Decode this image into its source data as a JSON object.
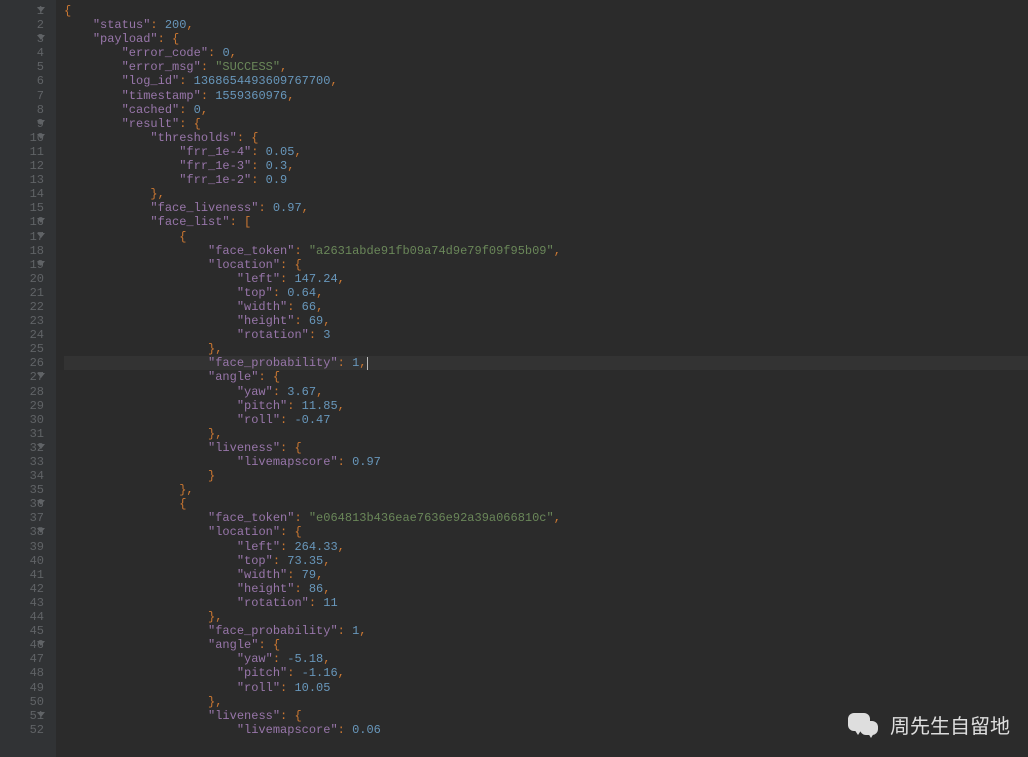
{
  "watermark_text": "周先生自留地",
  "highlighted_line": 26,
  "lines": [
    {
      "n": 1,
      "fold": true,
      "t": [
        [
          "p",
          "{"
        ]
      ]
    },
    {
      "n": 2,
      "t": [
        [
          "",
          "    "
        ],
        [
          "k",
          "\"status\""
        ],
        [
          "p",
          ": "
        ],
        [
          "n",
          "200"
        ],
        [
          "p",
          ","
        ]
      ]
    },
    {
      "n": 3,
      "fold": true,
      "t": [
        [
          "",
          "    "
        ],
        [
          "k",
          "\"payload\""
        ],
        [
          "p",
          ": {"
        ]
      ]
    },
    {
      "n": 4,
      "t": [
        [
          "",
          "        "
        ],
        [
          "k",
          "\"error_code\""
        ],
        [
          "p",
          ": "
        ],
        [
          "n",
          "0"
        ],
        [
          "p",
          ","
        ]
      ]
    },
    {
      "n": 5,
      "t": [
        [
          "",
          "        "
        ],
        [
          "k",
          "\"error_msg\""
        ],
        [
          "p",
          ": "
        ],
        [
          "s",
          "\"SUCCESS\""
        ],
        [
          "p",
          ","
        ]
      ]
    },
    {
      "n": 6,
      "t": [
        [
          "",
          "        "
        ],
        [
          "k",
          "\"log_id\""
        ],
        [
          "p",
          ": "
        ],
        [
          "n",
          "1368654493609767700"
        ],
        [
          "p",
          ","
        ]
      ]
    },
    {
      "n": 7,
      "t": [
        [
          "",
          "        "
        ],
        [
          "k",
          "\"timestamp\""
        ],
        [
          "p",
          ": "
        ],
        [
          "n",
          "1559360976"
        ],
        [
          "p",
          ","
        ]
      ]
    },
    {
      "n": 8,
      "t": [
        [
          "",
          "        "
        ],
        [
          "k",
          "\"cached\""
        ],
        [
          "p",
          ": "
        ],
        [
          "n",
          "0"
        ],
        [
          "p",
          ","
        ]
      ]
    },
    {
      "n": 9,
      "fold": true,
      "t": [
        [
          "",
          "        "
        ],
        [
          "k",
          "\"result\""
        ],
        [
          "p",
          ": {"
        ]
      ]
    },
    {
      "n": 10,
      "fold": true,
      "t": [
        [
          "",
          "            "
        ],
        [
          "k",
          "\"thresholds\""
        ],
        [
          "p",
          ": {"
        ]
      ]
    },
    {
      "n": 11,
      "t": [
        [
          "",
          "                "
        ],
        [
          "k",
          "\"frr_1e-4\""
        ],
        [
          "p",
          ": "
        ],
        [
          "n",
          "0.05"
        ],
        [
          "p",
          ","
        ]
      ]
    },
    {
      "n": 12,
      "t": [
        [
          "",
          "                "
        ],
        [
          "k",
          "\"frr_1e-3\""
        ],
        [
          "p",
          ": "
        ],
        [
          "n",
          "0.3"
        ],
        [
          "p",
          ","
        ]
      ]
    },
    {
      "n": 13,
      "t": [
        [
          "",
          "                "
        ],
        [
          "k",
          "\"frr_1e-2\""
        ],
        [
          "p",
          ": "
        ],
        [
          "n",
          "0.9"
        ]
      ]
    },
    {
      "n": 14,
      "t": [
        [
          "",
          "            "
        ],
        [
          "p",
          "},"
        ]
      ]
    },
    {
      "n": 15,
      "t": [
        [
          "",
          "            "
        ],
        [
          "k",
          "\"face_liveness\""
        ],
        [
          "p",
          ": "
        ],
        [
          "n",
          "0.97"
        ],
        [
          "p",
          ","
        ]
      ]
    },
    {
      "n": 16,
      "fold": true,
      "t": [
        [
          "",
          "            "
        ],
        [
          "k",
          "\"face_list\""
        ],
        [
          "p",
          ": ["
        ]
      ]
    },
    {
      "n": 17,
      "fold": true,
      "t": [
        [
          "",
          "                "
        ],
        [
          "p",
          "{"
        ]
      ]
    },
    {
      "n": 18,
      "t": [
        [
          "",
          "                    "
        ],
        [
          "k",
          "\"face_token\""
        ],
        [
          "p",
          ": "
        ],
        [
          "s",
          "\"a2631abde91fb09a74d9e79f09f95b09\""
        ],
        [
          "p",
          ","
        ]
      ]
    },
    {
      "n": 19,
      "fold": true,
      "t": [
        [
          "",
          "                    "
        ],
        [
          "k",
          "\"location\""
        ],
        [
          "p",
          ": {"
        ]
      ]
    },
    {
      "n": 20,
      "t": [
        [
          "",
          "                        "
        ],
        [
          "k",
          "\"left\""
        ],
        [
          "p",
          ": "
        ],
        [
          "n",
          "147.24"
        ],
        [
          "p",
          ","
        ]
      ]
    },
    {
      "n": 21,
      "t": [
        [
          "",
          "                        "
        ],
        [
          "k",
          "\"top\""
        ],
        [
          "p",
          ": "
        ],
        [
          "n",
          "0.64"
        ],
        [
          "p",
          ","
        ]
      ]
    },
    {
      "n": 22,
      "t": [
        [
          "",
          "                        "
        ],
        [
          "k",
          "\"width\""
        ],
        [
          "p",
          ": "
        ],
        [
          "n",
          "66"
        ],
        [
          "p",
          ","
        ]
      ]
    },
    {
      "n": 23,
      "t": [
        [
          "",
          "                        "
        ],
        [
          "k",
          "\"height\""
        ],
        [
          "p",
          ": "
        ],
        [
          "n",
          "69"
        ],
        [
          "p",
          ","
        ]
      ]
    },
    {
      "n": 24,
      "t": [
        [
          "",
          "                        "
        ],
        [
          "k",
          "\"rotation\""
        ],
        [
          "p",
          ": "
        ],
        [
          "n",
          "3"
        ]
      ]
    },
    {
      "n": 25,
      "t": [
        [
          "",
          "                    "
        ],
        [
          "p",
          "},"
        ]
      ]
    },
    {
      "n": 26,
      "t": [
        [
          "",
          "                    "
        ],
        [
          "k",
          "\"face_probability\""
        ],
        [
          "p",
          ": "
        ],
        [
          "n",
          "1"
        ],
        [
          "p",
          ","
        ],
        [
          "cursor",
          ""
        ]
      ]
    },
    {
      "n": 27,
      "fold": true,
      "t": [
        [
          "",
          "                    "
        ],
        [
          "k",
          "\"angle\""
        ],
        [
          "p",
          ": {"
        ]
      ]
    },
    {
      "n": 28,
      "t": [
        [
          "",
          "                        "
        ],
        [
          "k",
          "\"yaw\""
        ],
        [
          "p",
          ": "
        ],
        [
          "n",
          "3.67"
        ],
        [
          "p",
          ","
        ]
      ]
    },
    {
      "n": 29,
      "t": [
        [
          "",
          "                        "
        ],
        [
          "k",
          "\"pitch\""
        ],
        [
          "p",
          ": "
        ],
        [
          "n",
          "11.85"
        ],
        [
          "p",
          ","
        ]
      ]
    },
    {
      "n": 30,
      "t": [
        [
          "",
          "                        "
        ],
        [
          "k",
          "\"roll\""
        ],
        [
          "p",
          ": "
        ],
        [
          "n",
          "-0.47"
        ]
      ]
    },
    {
      "n": 31,
      "t": [
        [
          "",
          "                    "
        ],
        [
          "p",
          "},"
        ]
      ]
    },
    {
      "n": 32,
      "fold": true,
      "t": [
        [
          "",
          "                    "
        ],
        [
          "k",
          "\"liveness\""
        ],
        [
          "p",
          ": {"
        ]
      ]
    },
    {
      "n": 33,
      "t": [
        [
          "",
          "                        "
        ],
        [
          "k",
          "\"livemapscore\""
        ],
        [
          "p",
          ": "
        ],
        [
          "n",
          "0.97"
        ]
      ]
    },
    {
      "n": 34,
      "t": [
        [
          "",
          "                    "
        ],
        [
          "p",
          "}"
        ]
      ]
    },
    {
      "n": 35,
      "t": [
        [
          "",
          "                "
        ],
        [
          "p",
          "},"
        ]
      ]
    },
    {
      "n": 36,
      "fold": true,
      "t": [
        [
          "",
          "                "
        ],
        [
          "p",
          "{"
        ]
      ]
    },
    {
      "n": 37,
      "t": [
        [
          "",
          "                    "
        ],
        [
          "k",
          "\"face_token\""
        ],
        [
          "p",
          ": "
        ],
        [
          "s",
          "\"e064813b436eae7636e92a39a066810c\""
        ],
        [
          "p",
          ","
        ]
      ]
    },
    {
      "n": 38,
      "fold": true,
      "t": [
        [
          "",
          "                    "
        ],
        [
          "k",
          "\"location\""
        ],
        [
          "p",
          ": {"
        ]
      ]
    },
    {
      "n": 39,
      "t": [
        [
          "",
          "                        "
        ],
        [
          "k",
          "\"left\""
        ],
        [
          "p",
          ": "
        ],
        [
          "n",
          "264.33"
        ],
        [
          "p",
          ","
        ]
      ]
    },
    {
      "n": 40,
      "t": [
        [
          "",
          "                        "
        ],
        [
          "k",
          "\"top\""
        ],
        [
          "p",
          ": "
        ],
        [
          "n",
          "73.35"
        ],
        [
          "p",
          ","
        ]
      ]
    },
    {
      "n": 41,
      "t": [
        [
          "",
          "                        "
        ],
        [
          "k",
          "\"width\""
        ],
        [
          "p",
          ": "
        ],
        [
          "n",
          "79"
        ],
        [
          "p",
          ","
        ]
      ]
    },
    {
      "n": 42,
      "t": [
        [
          "",
          "                        "
        ],
        [
          "k",
          "\"height\""
        ],
        [
          "p",
          ": "
        ],
        [
          "n",
          "86"
        ],
        [
          "p",
          ","
        ]
      ]
    },
    {
      "n": 43,
      "t": [
        [
          "",
          "                        "
        ],
        [
          "k",
          "\"rotation\""
        ],
        [
          "p",
          ": "
        ],
        [
          "n",
          "11"
        ]
      ]
    },
    {
      "n": 44,
      "t": [
        [
          "",
          "                    "
        ],
        [
          "p",
          "},"
        ]
      ]
    },
    {
      "n": 45,
      "t": [
        [
          "",
          "                    "
        ],
        [
          "k",
          "\"face_probability\""
        ],
        [
          "p",
          ": "
        ],
        [
          "n",
          "1"
        ],
        [
          "p",
          ","
        ]
      ]
    },
    {
      "n": 46,
      "fold": true,
      "t": [
        [
          "",
          "                    "
        ],
        [
          "k",
          "\"angle\""
        ],
        [
          "p",
          ": {"
        ]
      ]
    },
    {
      "n": 47,
      "t": [
        [
          "",
          "                        "
        ],
        [
          "k",
          "\"yaw\""
        ],
        [
          "p",
          ": "
        ],
        [
          "n",
          "-5.18"
        ],
        [
          "p",
          ","
        ]
      ]
    },
    {
      "n": 48,
      "t": [
        [
          "",
          "                        "
        ],
        [
          "k",
          "\"pitch\""
        ],
        [
          "p",
          ": "
        ],
        [
          "n",
          "-1.16"
        ],
        [
          "p",
          ","
        ]
      ]
    },
    {
      "n": 49,
      "t": [
        [
          "",
          "                        "
        ],
        [
          "k",
          "\"roll\""
        ],
        [
          "p",
          ": "
        ],
        [
          "n",
          "10.05"
        ]
      ]
    },
    {
      "n": 50,
      "t": [
        [
          "",
          "                    "
        ],
        [
          "p",
          "},"
        ]
      ]
    },
    {
      "n": 51,
      "fold": true,
      "t": [
        [
          "",
          "                    "
        ],
        [
          "k",
          "\"liveness\""
        ],
        [
          "p",
          ": {"
        ]
      ]
    },
    {
      "n": 52,
      "t": [
        [
          "",
          "                        "
        ],
        [
          "k",
          "\"livemapscore\""
        ],
        [
          "p",
          ": "
        ],
        [
          "n",
          "0.06"
        ]
      ]
    }
  ]
}
